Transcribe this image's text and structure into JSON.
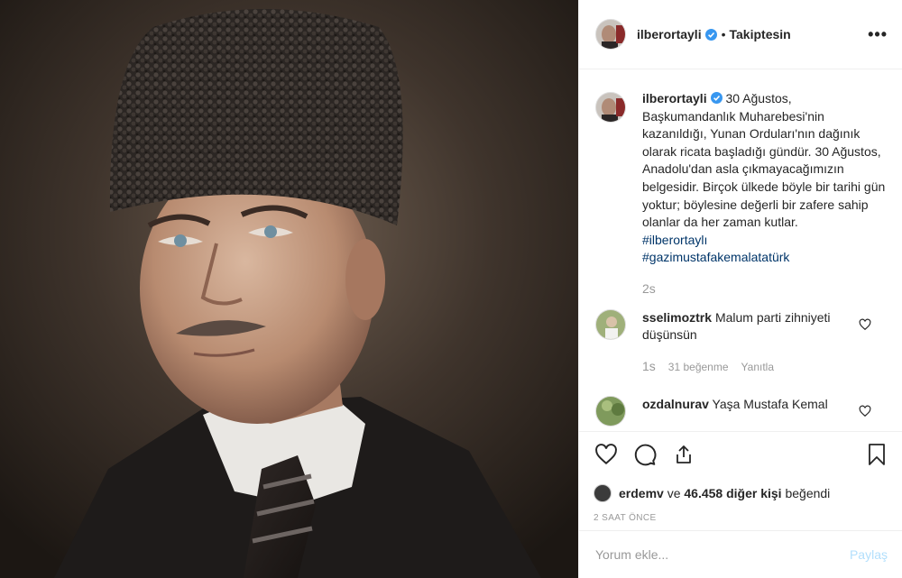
{
  "header": {
    "username": "ilberortayli",
    "follow_state": "Takiptesin",
    "separator": "•"
  },
  "caption": {
    "username": "ilberortayli",
    "text": "30 Ağustos, Başkumandanlık Muharebesi'nin kazanıldığı, Yunan Orduları'nın dağınık olarak ricata başladığı gündür. 30 Ağustos, Anadolu'dan asla çıkmayacağımızın belgesidir. Birçok ülkede böyle bir tarihi gün yoktur; böylesine değerli bir zafere sahip olanlar da her zaman kutlar.",
    "hashtags": [
      "#ilberortaylı",
      "#gazimustafakemalatatürk"
    ],
    "time": "2s"
  },
  "comments": [
    {
      "username": "sselimoztrk",
      "text": "Malum parti zihniyeti düşünsün",
      "time": "1s",
      "likes": "31 beğenme",
      "reply": "Yanıtla"
    },
    {
      "username": "ozdalnurav",
      "text": "Yaşa Mustafa Kemal"
    }
  ],
  "likes": {
    "first_liker": "erdemv",
    "connector": " ve ",
    "others": "46.458 diğer kişi",
    "suffix": " beğendi"
  },
  "post_time": "2 SAAT ÖNCE",
  "add_comment": {
    "placeholder": "Yorum ekle...",
    "post_label": "Paylaş"
  },
  "colors": {
    "verified": "#3897f0",
    "hashtag": "#003569",
    "post_button_disabled": "#b2dffc",
    "muted": "#999999"
  }
}
